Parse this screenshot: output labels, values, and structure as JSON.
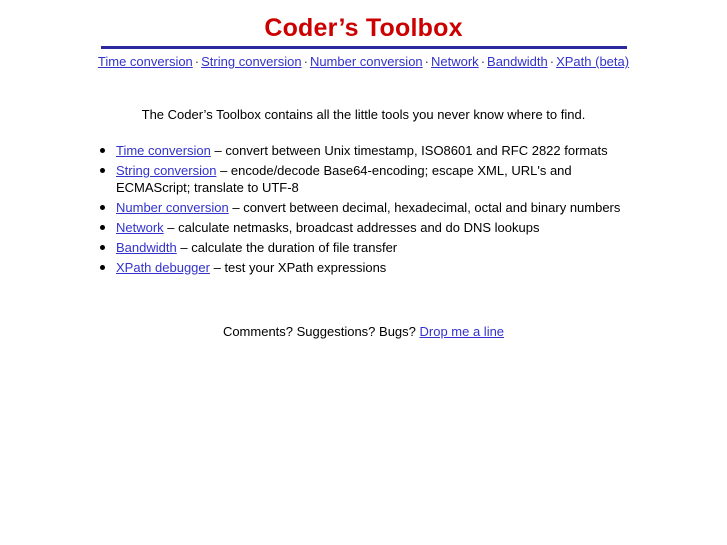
{
  "header": {
    "title": "Coder’s Toolbox",
    "rule_color": "#2a2a9c",
    "title_color": "#cc0000"
  },
  "nav": {
    "separator": "·",
    "link_color": "#3333cc",
    "items": [
      {
        "label": "Time conversion"
      },
      {
        "label": "String conversion"
      },
      {
        "label": "Number conversion"
      },
      {
        "label": "Network"
      },
      {
        "label": "Bandwidth"
      },
      {
        "label": "XPath (beta)"
      }
    ]
  },
  "main": {
    "intro": "The Coder’s Toolbox contains all the little tools you never know where to find.",
    "dash": " – ",
    "tools": [
      {
        "link": "Time conversion",
        "description": "convert between Unix timestamp, ISO8601 and RFC 2822 formats"
      },
      {
        "link": "String conversion",
        "description": "encode/decode Base64-encoding; escape XML, URL's and ECMAScript; translate to UTF-8"
      },
      {
        "link": "Number conversion",
        "description": "convert between decimal, hexadecimal, octal and binary numbers"
      },
      {
        "link": "Network",
        "description": "calculate netmasks, broadcast addresses and do DNS lookups"
      },
      {
        "link": "Bandwidth",
        "description": "calculate the duration of file transfer"
      },
      {
        "link": "XPath debugger",
        "description": "test your XPath expressions"
      }
    ]
  },
  "footer": {
    "text": "Comments? Suggestions? Bugs? ",
    "link": "Drop me a line"
  }
}
